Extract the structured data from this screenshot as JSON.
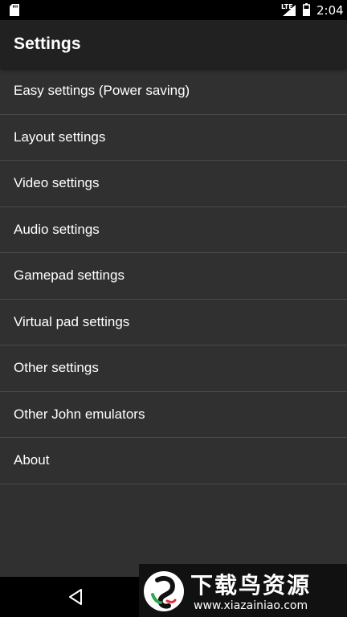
{
  "status_bar": {
    "network": "LTE",
    "time": "2:04",
    "icons": [
      "sd-card-icon",
      "signal-icon",
      "battery-icon"
    ]
  },
  "app_bar": {
    "title": "Settings"
  },
  "settings": {
    "items": [
      {
        "label": "Easy settings (Power saving)"
      },
      {
        "label": "Layout settings"
      },
      {
        "label": "Video settings"
      },
      {
        "label": "Audio settings"
      },
      {
        "label": "Gamepad settings"
      },
      {
        "label": "Virtual pad settings"
      },
      {
        "label": "Other settings"
      },
      {
        "label": "Other John emulators"
      },
      {
        "label": "About"
      }
    ]
  },
  "nav_bar": {
    "icons": [
      "back-icon"
    ]
  },
  "watermark": {
    "title": "下载鸟资源",
    "url": "www.xiazainiao.com"
  },
  "colors": {
    "background": "#303030",
    "app_bar": "#212121",
    "divider": "#4a4a4a",
    "text": "#ffffff"
  }
}
